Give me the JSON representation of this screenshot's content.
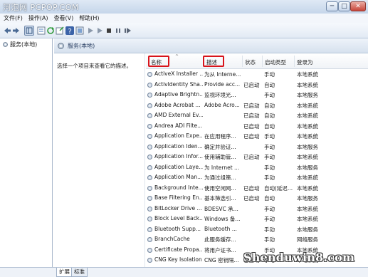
{
  "titlebar": {
    "watermark_text": "河泡网 PCPOP.COM",
    "minimize": "─",
    "maximize": "□",
    "close": "✕"
  },
  "menu": [
    "文件(F)",
    "操作(A)",
    "查看(V)",
    "帮助(H)"
  ],
  "toolbar_icons": [
    "back-arrow-icon",
    "forward-arrow-icon",
    "console-tree-icon",
    "properties-icon",
    "refresh-icon",
    "export-icon",
    "help-icon",
    "panel-icon",
    "play-icon",
    "play-alt-icon",
    "stop-icon",
    "pause-icon",
    "restart-icon"
  ],
  "tree": {
    "root_label": "服务(本地)"
  },
  "pane": {
    "header_label": "服务(本地)",
    "description_prompt": "选择一个项目来查看它的描述。"
  },
  "columns": {
    "name": "名称",
    "desc": "描述",
    "status": "状态",
    "startup": "启动类型",
    "logon": "登录为"
  },
  "highlight_color": "#d8141b",
  "services": [
    {
      "name": "ActiveX Installer ...",
      "desc": "为从 Interne...",
      "status": "",
      "startup": "手动",
      "logon": "本地系统"
    },
    {
      "name": "ActivIdentity Sha...",
      "desc": "Provide acc...",
      "status": "已启动",
      "startup": "自动",
      "logon": "本地系统"
    },
    {
      "name": "Adaptive Brightn...",
      "desc": "监视环境光...",
      "status": "",
      "startup": "手动",
      "logon": "本地服务"
    },
    {
      "name": "Adobe Acrobat ...",
      "desc": "Adobe Acro...",
      "status": "已启动",
      "startup": "自动",
      "logon": "本地系统"
    },
    {
      "name": "AMD External Ev...",
      "desc": "",
      "status": "已启动",
      "startup": "自动",
      "logon": "本地系统"
    },
    {
      "name": "Andrea ADI Filte...",
      "desc": "",
      "status": "已启动",
      "startup": "自动",
      "logon": "本地系统"
    },
    {
      "name": "Application Expe...",
      "desc": "在应用程序...",
      "status": "已启动",
      "startup": "手动",
      "logon": "本地系统"
    },
    {
      "name": "Application Iden...",
      "desc": "确定并验证...",
      "status": "",
      "startup": "手动",
      "logon": "本地服务"
    },
    {
      "name": "Application Infor...",
      "desc": "使用辅助管...",
      "status": "已启动",
      "startup": "手动",
      "logon": "本地系统"
    },
    {
      "name": "Application Laye...",
      "desc": "为 Internet ...",
      "status": "",
      "startup": "手动",
      "logon": "本地服务"
    },
    {
      "name": "Application Man...",
      "desc": "为通过组策...",
      "status": "",
      "startup": "手动",
      "logon": "本地系统"
    },
    {
      "name": "Background Inte...",
      "desc": "使用空闲网...",
      "status": "已启动",
      "startup": "自动(延迟...",
      "logon": "本地系统"
    },
    {
      "name": "Base Filtering En...",
      "desc": "基本筛选引...",
      "status": "已启动",
      "startup": "自动",
      "logon": "本地服务"
    },
    {
      "name": "BitLocker Drive ...",
      "desc": "BDESVC 承...",
      "status": "",
      "startup": "手动",
      "logon": "本地系统"
    },
    {
      "name": "Block Level Back...",
      "desc": "Windows 备...",
      "status": "",
      "startup": "手动",
      "logon": "本地系统"
    },
    {
      "name": "Bluetooth Supp...",
      "desc": "Bluetooth ...",
      "status": "",
      "startup": "手动",
      "logon": "本地服务"
    },
    {
      "name": "BranchCache",
      "desc": "此服务缓存...",
      "status": "",
      "startup": "手动",
      "logon": "网络服务"
    },
    {
      "name": "Certificate Propa...",
      "desc": "将用户证书...",
      "status": "",
      "startup": "手动",
      "logon": "本地系统"
    },
    {
      "name": "CNG Key Isolation",
      "desc": "CNG 密钥隔...",
      "status": "已启动",
      "startup": "手动",
      "logon": "本地系统"
    }
  ],
  "bottom_tabs": [
    "扩展",
    "标准"
  ],
  "watermark": "Shenduwin8.com"
}
